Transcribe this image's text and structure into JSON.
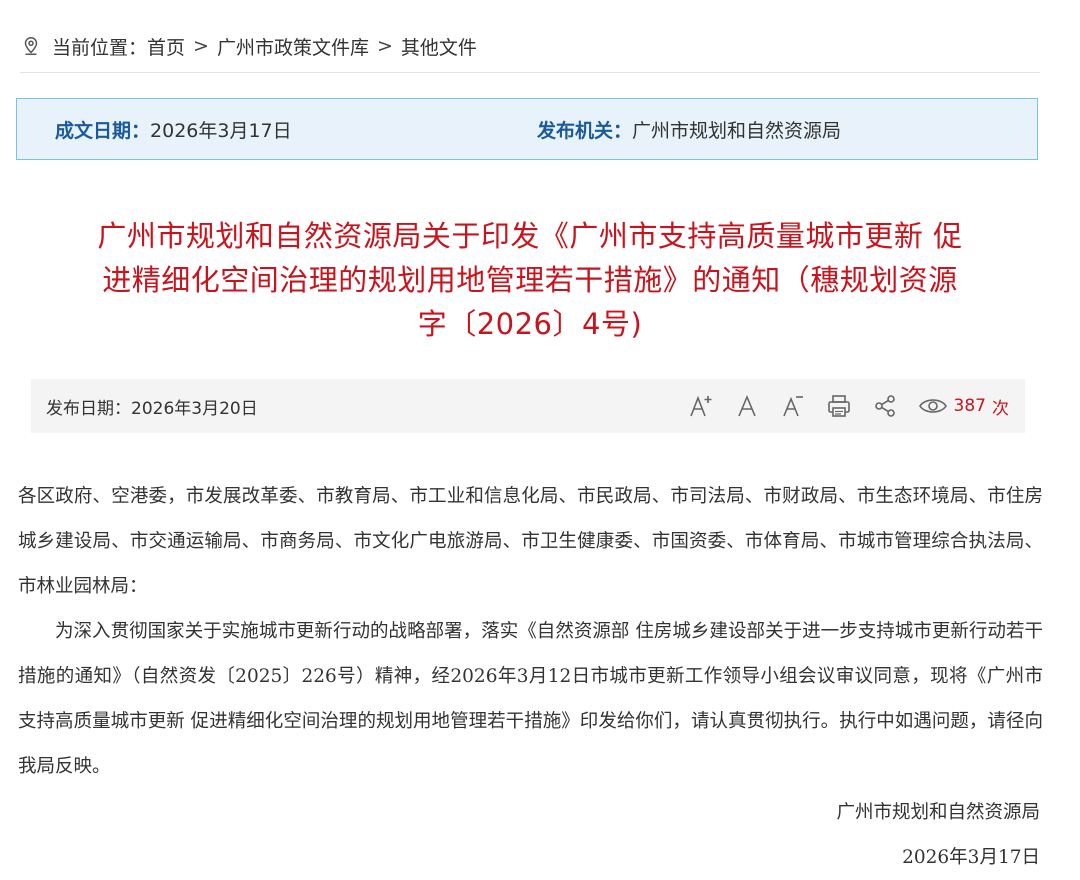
{
  "breadcrumb": {
    "prefix": "当前位置：",
    "items": [
      "首页",
      "广州市政策文件库",
      "其他文件"
    ],
    "separator": ">"
  },
  "info": {
    "date_label": "成文日期：",
    "date_value": "2026年3月17日",
    "issuer_label": "发布机关：",
    "issuer_value": "广州市规划和自然资源局"
  },
  "title": {
    "line1": "广州市规划和自然资源局关于印发《广州市支持高质量城市更新 促",
    "line2": "进精细化空间治理的规划用地管理若干措施》的通知（穗规划资源",
    "line3": "字〔2026〕4号)"
  },
  "toolbar": {
    "pubdate": "发布日期：2026年3月20日",
    "view_count": "387",
    "view_unit": "次"
  },
  "content": {
    "recipients": "各区政府、空港委，市发展改革委、市教育局、市工业和信息化局、市民政局、市司法局、市财政局、市生态环境局、市住房城乡建设局、市交通运输局、市商务局、市文化广电旅游局、市卫生健康委、市国资委、市体育局、市城市管理综合执法局、市林业园林局：",
    "paragraph": "为深入贯彻国家关于实施城市更新行动的战略部署，落实《自然资源部 住房城乡建设部关于进一步支持城市更新行动若干措施的通知》（自然资发〔2025〕226号）精神，经2026年3月12日市城市更新工作领导小组会议审议同意，现将《广州市支持高质量城市更新 促进精细化空间治理的规划用地管理若干措施》印发给你们，请认真贯彻执行。执行中如遇问题，请径向我局反映。"
  },
  "signature": {
    "org": "广州市规划和自然资源局",
    "date": "2026年3月17日"
  },
  "colors": {
    "title_red": "#c8141c",
    "label_blue": "#1a5a9a",
    "info_bg": "#e7f2fb",
    "info_border": "#7cc0e6",
    "toolbar_bg": "#f4f4f4"
  }
}
